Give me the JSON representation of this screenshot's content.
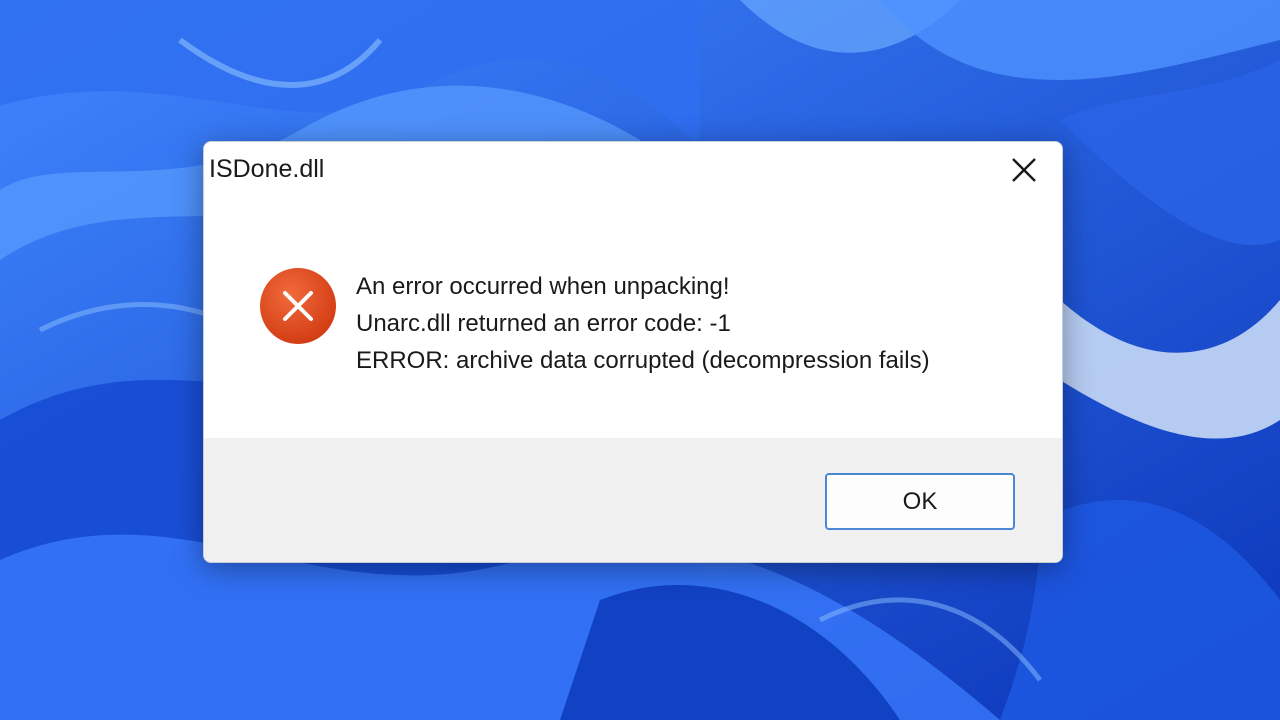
{
  "dialog": {
    "title": "ISDone.dll",
    "close_icon": "close-icon",
    "status_icon": "error-icon",
    "messages": [
      "An error occurred when unpacking!",
      "Unarc.dll returned an error code: -1",
      "ERROR: archive data corrupted (decompression fails)"
    ],
    "ok_label": "OK"
  },
  "colors": {
    "wallpaper": "#1e4fd8",
    "error_icon": "#e0441f",
    "button_border": "#4a88d6",
    "footer": "#f0f0f0"
  }
}
